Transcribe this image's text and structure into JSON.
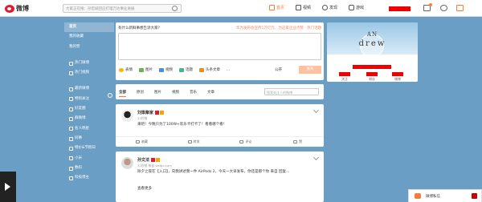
{
  "header": {
    "logo_text": "微博",
    "search_placeholder": "大家正在搜：孙宏斌回应打理万达事业进展",
    "nav": [
      {
        "label": "首页",
        "icon": "home-icon",
        "active": true
      },
      {
        "label": "视频",
        "icon": "video-icon",
        "active": false
      },
      {
        "label": "发现",
        "icon": "discover-icon",
        "active": false
      },
      {
        "label": "游戏",
        "icon": "game-icon",
        "active": false
      }
    ]
  },
  "sidebar": {
    "items": [
      {
        "label": "首页",
        "bold": true,
        "selected": true
      },
      {
        "label": "我的收藏",
        "bold": false
      },
      {
        "label": "我的赞",
        "bold": false
      },
      {
        "label": "热门微博",
        "bold": false,
        "gap": true
      },
      {
        "label": "热门视频",
        "bold": false
      },
      {
        "label": "最新微博",
        "bold": false,
        "gap": true
      },
      {
        "label": "特别关注",
        "bold": false
      },
      {
        "label": "好友圈",
        "bold": false
      },
      {
        "label": "群微博",
        "bold": false
      },
      {
        "label": "名人明星",
        "bold": false
      },
      {
        "label": "同事",
        "bold": false
      },
      {
        "label": "特价&节假日",
        "bold": false
      },
      {
        "label": "小米",
        "bold": false
      },
      {
        "label": "数码",
        "bold": false
      },
      {
        "label": "科技博主",
        "bold": false
      }
    ]
  },
  "publisher": {
    "prompt": "有什么新鲜事想告诉大家？",
    "hot": "华为发布会宣传1万亿元，为这家企业点赞 · 热门话题",
    "tools": [
      "表情",
      "图片",
      "视频",
      "话题",
      "头条文章",
      "..."
    ],
    "visibility": "公开",
    "send_label": "发布"
  },
  "feed_filter": {
    "tabs": [
      "全部",
      "原创",
      "图片",
      "视频",
      "音乐",
      "文章"
    ],
    "search_placeholder": "搜我关注人的微博"
  },
  "posts": [
    {
      "author": "刘策聚家",
      "meta": "32秒前",
      "text": "来吧！今晚只为了100W+欢乐卡打卡了！看看哪个看！",
      "actions": [
        "收藏",
        "转发",
        "评论",
        "赞"
      ]
    },
    {
      "author": "孙文法",
      "meta": "32秒前 来自 weibo.com",
      "text": "除夕之夜在【入口】，向我讲述我一件 AirPods 2，今天一大早发布，你还是那个你 来自 回复…",
      "text2": "查看更多",
      "actions": [
        "收藏",
        "转发",
        "评论",
        "赞"
      ]
    }
  ],
  "profile": {
    "line1": "AN",
    "line2": "drew",
    "stats": [
      "关注",
      "粉丝",
      "微博"
    ]
  },
  "chat": {
    "label": "微博私信"
  }
}
